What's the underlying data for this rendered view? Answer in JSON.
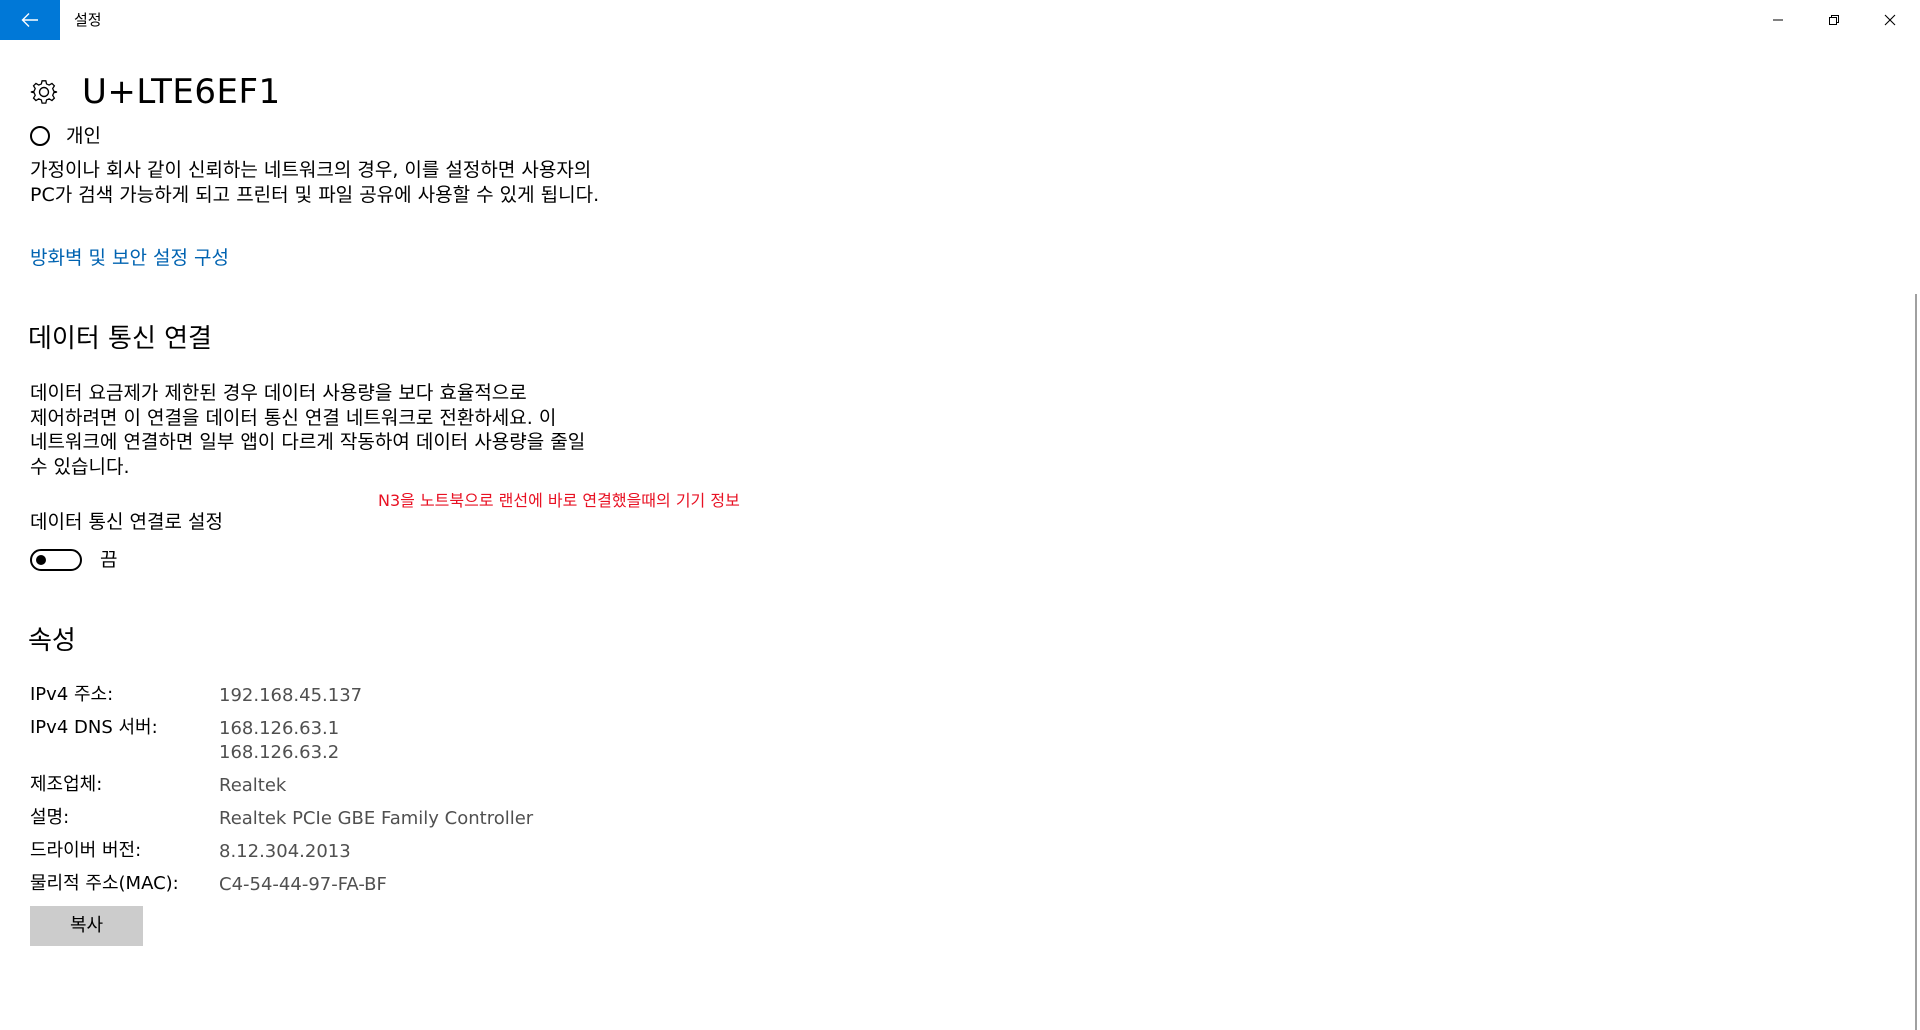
{
  "titlebar": {
    "back_icon": "arrow-left-icon",
    "title": "설정",
    "accent_color": "#0078d7",
    "controls": [
      "minimize-icon",
      "restore-icon",
      "close-icon"
    ]
  },
  "header": {
    "icon": "gear-icon",
    "title": "U+LTE6EF1"
  },
  "network_profile": {
    "private_label": "개인",
    "private_selected": false,
    "private_description": "가정이나 회사 같이 신뢰하는 네트워크의 경우, 이를 설정하면 사용자의 PC가 검색 가능하게 되고 프린터 및 파일 공유에 사용할 수 있게 됩니다.",
    "firewall_link": "방화벽 및 보안 설정 구성",
    "link_color": "#0063b1"
  },
  "metered": {
    "heading": "데이터 통신 연결",
    "description": "데이터 요금제가 제한된 경우 데이터 사용량을 보다 효율적으로 제어하려면 이 연결을 데이터 통신 연결 네트워크로 전환하세요. 이 네트워크에 연결하면 일부 앱이 다르게 작동하여 데이터 사용량을 줄일 수 있습니다.",
    "toggle_label": "데이터 통신 연결로 설정",
    "toggle_state": "끔",
    "toggle_on": false
  },
  "annotation": {
    "text": "N3을 노트북으로 랜선에 바로 연결했을때의 기기 정보",
    "color": "#e81123"
  },
  "properties": {
    "heading": "속성",
    "ipv4_label": "IPv4 주소:",
    "ipv4_value": "192.168.45.137",
    "dns_label": "IPv4 DNS 서버:",
    "dns_value_1": "168.126.63.1",
    "dns_value_2": "168.126.63.2",
    "manufacturer_label": "제조업체:",
    "manufacturer_value": "Realtek",
    "description_label": "설명:",
    "description_value": "Realtek PCIe GBE Family Controller",
    "driver_label": "드라이버 버전:",
    "driver_value": "8.12.304.2013",
    "mac_label": "물리적 주소(MAC):",
    "mac_value": "C4-54-44-97-FA-BF",
    "copy_button": "복사"
  }
}
